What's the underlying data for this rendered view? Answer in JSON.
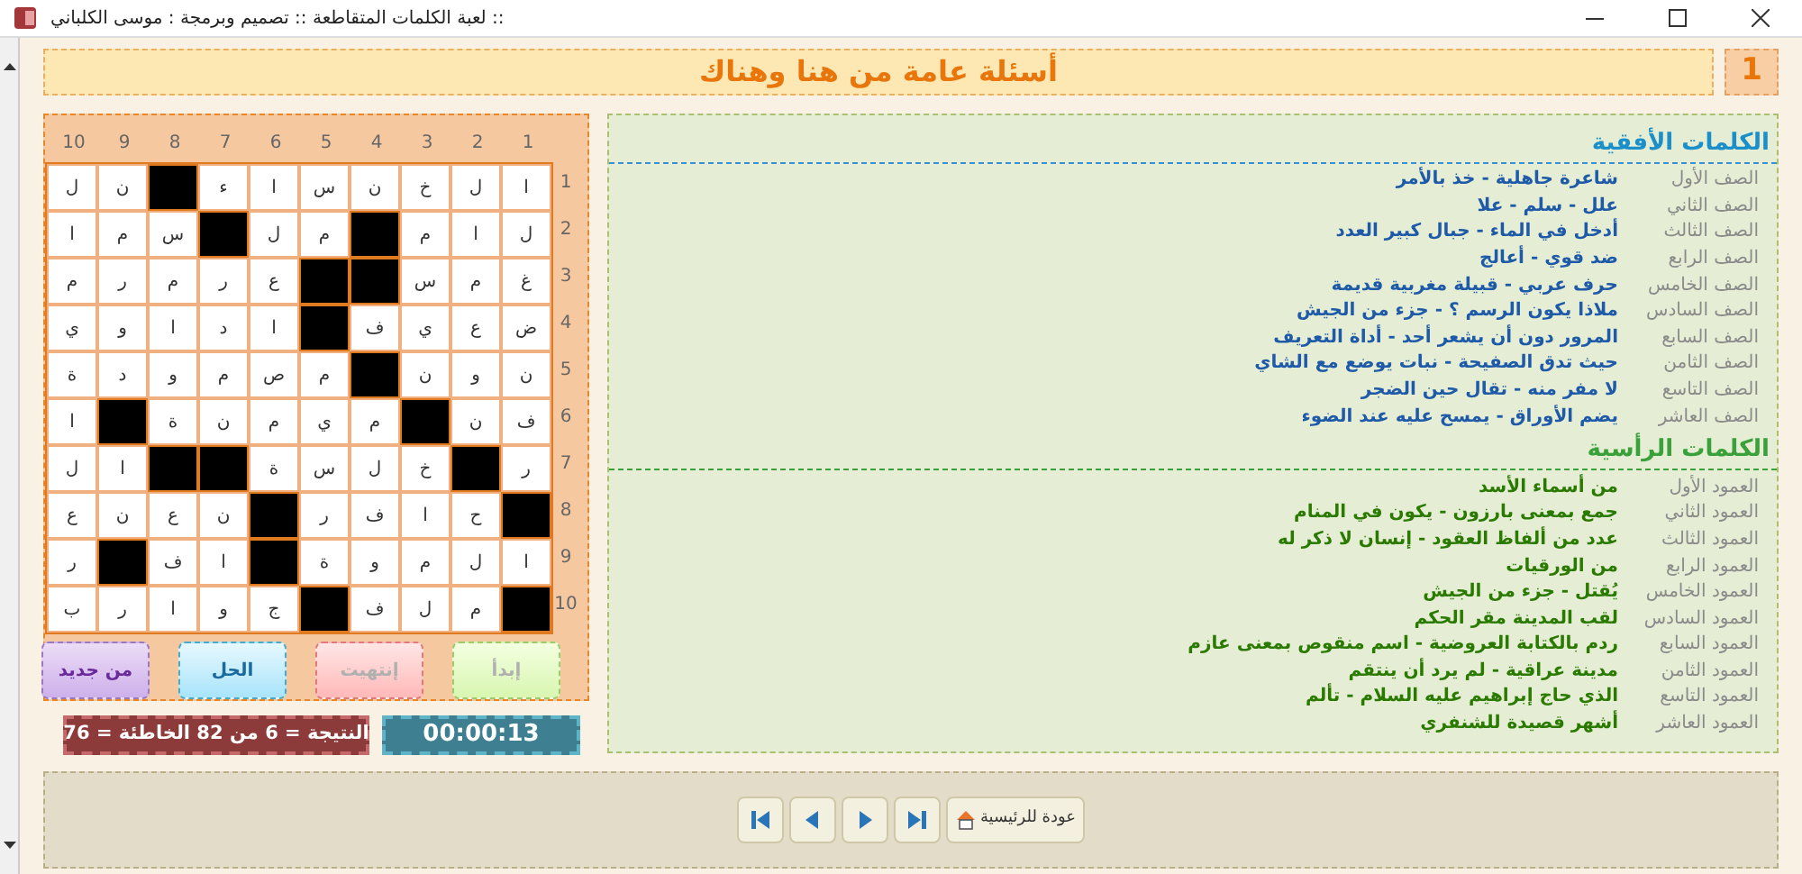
{
  "window": {
    "title": "لعبة الكلمات المتقاطعة :: تصميم وبرمجة : موسى الكلباني ::"
  },
  "header": {
    "number": "1",
    "title": "أسئلة عامة من هنا وهناك"
  },
  "grid": {
    "column_numbers": [
      "1",
      "2",
      "3",
      "4",
      "5",
      "6",
      "7",
      "8",
      "9",
      "10"
    ],
    "row_numbers": [
      "1",
      "2",
      "3",
      "4",
      "5",
      "6",
      "7",
      "8",
      "9",
      "10"
    ],
    "rows": [
      [
        {
          "letter": "ا",
          "black": false
        },
        {
          "letter": "ل",
          "black": false
        },
        {
          "letter": "خ",
          "black": false
        },
        {
          "letter": "ن",
          "black": false
        },
        {
          "letter": "س",
          "black": false
        },
        {
          "letter": "ا",
          "black": false
        },
        {
          "letter": "ء",
          "black": false
        },
        {
          "black": true
        },
        {
          "letter": "ن",
          "black": false
        },
        {
          "letter": "ل",
          "black": false
        }
      ],
      [
        {
          "letter": "ل",
          "black": false
        },
        {
          "letter": "ا",
          "black": false
        },
        {
          "letter": "م",
          "black": false
        },
        {
          "black": true
        },
        {
          "letter": "م",
          "black": false
        },
        {
          "letter": "ل",
          "black": false
        },
        {
          "black": true
        },
        {
          "letter": "س",
          "black": false
        },
        {
          "letter": "م",
          "black": false
        },
        {
          "letter": "ا",
          "black": false
        }
      ],
      [
        {
          "letter": "غ",
          "black": false
        },
        {
          "letter": "م",
          "black": false
        },
        {
          "letter": "س",
          "black": false
        },
        {
          "black": true
        },
        {
          "black": true
        },
        {
          "letter": "ع",
          "black": false
        },
        {
          "letter": "ر",
          "black": false
        },
        {
          "letter": "م",
          "black": false
        },
        {
          "letter": "ر",
          "black": false
        },
        {
          "letter": "م",
          "black": false
        }
      ],
      [
        {
          "letter": "ض",
          "black": false
        },
        {
          "letter": "ع",
          "black": false
        },
        {
          "letter": "ي",
          "black": false
        },
        {
          "letter": "ف",
          "black": false
        },
        {
          "black": true
        },
        {
          "letter": "ا",
          "black": false
        },
        {
          "letter": "د",
          "black": false
        },
        {
          "letter": "ا",
          "black": false
        },
        {
          "letter": "و",
          "black": false
        },
        {
          "letter": "ي",
          "black": false
        }
      ],
      [
        {
          "letter": "ن",
          "black": false
        },
        {
          "letter": "و",
          "black": false
        },
        {
          "letter": "ن",
          "black": false
        },
        {
          "black": true
        },
        {
          "letter": "م",
          "black": false
        },
        {
          "letter": "ص",
          "black": false
        },
        {
          "letter": "م",
          "black": false
        },
        {
          "letter": "و",
          "black": false
        },
        {
          "letter": "د",
          "black": false
        },
        {
          "letter": "ة",
          "black": false
        }
      ],
      [
        {
          "letter": "ف",
          "black": false
        },
        {
          "letter": "ن",
          "black": false
        },
        {
          "black": true
        },
        {
          "letter": "م",
          "black": false
        },
        {
          "letter": "ي",
          "black": false
        },
        {
          "letter": "م",
          "black": false
        },
        {
          "letter": "ن",
          "black": false
        },
        {
          "letter": "ة",
          "black": false
        },
        {
          "black": true
        },
        {
          "letter": "ا",
          "black": false
        }
      ],
      [
        {
          "letter": "ر",
          "black": false
        },
        {
          "black": true
        },
        {
          "letter": "خ",
          "black": false
        },
        {
          "letter": "ل",
          "black": false
        },
        {
          "letter": "س",
          "black": false
        },
        {
          "letter": "ة",
          "black": false
        },
        {
          "black": true
        },
        {
          "black": true
        },
        {
          "letter": "ا",
          "black": false
        },
        {
          "letter": "ل",
          "black": false
        }
      ],
      [
        {
          "black": true
        },
        {
          "letter": "ح",
          "black": false
        },
        {
          "letter": "ا",
          "black": false
        },
        {
          "letter": "ف",
          "black": false
        },
        {
          "letter": "ر",
          "black": false
        },
        {
          "black": true
        },
        {
          "letter": "ن",
          "black": false
        },
        {
          "letter": "ع",
          "black": false
        },
        {
          "letter": "ن",
          "black": false
        },
        {
          "letter": "ع",
          "black": false
        }
      ],
      [
        {
          "letter": "ا",
          "black": false
        },
        {
          "letter": "ل",
          "black": false
        },
        {
          "letter": "م",
          "black": false
        },
        {
          "letter": "و",
          "black": false
        },
        {
          "letter": "ة",
          "black": false
        },
        {
          "black": true
        },
        {
          "letter": "ا",
          "black": false
        },
        {
          "letter": "ف",
          "black": false
        },
        {
          "black": true
        },
        {
          "letter": "ر",
          "black": false
        }
      ],
      [
        {
          "black": true
        },
        {
          "letter": "م",
          "black": false
        },
        {
          "letter": "ل",
          "black": false
        },
        {
          "letter": "ف",
          "black": false
        },
        {
          "black": true
        },
        {
          "letter": "ج",
          "black": false
        },
        {
          "letter": "و",
          "black": false
        },
        {
          "letter": "ا",
          "black": false
        },
        {
          "letter": "ر",
          "black": false
        },
        {
          "letter": "ب",
          "black": false
        }
      ]
    ]
  },
  "buttons": [
    {
      "label": "إبدأ",
      "kind": "start",
      "disabled": true
    },
    {
      "label": "إنتهيت",
      "kind": "finish",
      "disabled": true
    },
    {
      "label": "الحل",
      "kind": "solve",
      "disabled": false
    },
    {
      "label": "من جديد",
      "kind": "restart",
      "disabled": false
    }
  ],
  "timer": "00:00:13",
  "score": "النتيجة = 6 من 82 الخاطئة = 76",
  "across": {
    "heading": "الكلمات الأفقية",
    "clues": [
      {
        "label": "الصف الأول",
        "text": "شاعرة جاهلية - خذ بالأمر"
      },
      {
        "label": "الصف الثاني",
        "text": "علل  -  سلم  -  علا"
      },
      {
        "label": "الصف الثالث",
        "text": "أدخل في الماء -  جبال كبير العدد"
      },
      {
        "label": "الصف الرابع",
        "text": "ضد قوي  -  أعالج"
      },
      {
        "label": "الصف الخامس",
        "text": "حرف عربي  -  قبيلة مغربية قديمة"
      },
      {
        "label": "الصف السادس",
        "text": "ملاذا يكون الرسم ؟ - جزء من الجيش"
      },
      {
        "label": "الصف السابع",
        "text": "المرور دون أن يشعر أحد  - أداة التعريف"
      },
      {
        "label": "الصف الثامن",
        "text": "حيث تدق الصفيحة  -  نبات يوضع مع الشاي"
      },
      {
        "label": "الصف التاسع",
        "text": "لا مفر منه  - تقال حين الضجر"
      },
      {
        "label": "الصف العاشر",
        "text": "يضم الأوراق  - يمسح عليه عند الضوء"
      }
    ]
  },
  "down": {
    "heading": "الكلمات الرأسية",
    "clues": [
      {
        "label": "العمود الأول",
        "text": "من أسماء الأسد"
      },
      {
        "label": "العمود الثاني",
        "text": "جمع بمعنى بارزون  -  يكون في المنام"
      },
      {
        "label": "العمود الثالث",
        "text": "عدد من ألفاظ العقود  -  إنسان لا ذكر له"
      },
      {
        "label": "العمود الرابع",
        "text": "من الورقيات"
      },
      {
        "label": "العمود الخامس",
        "text": "يُقتل - جزء من الجيش"
      },
      {
        "label": "العمود السادس",
        "text": "لقب المدينة مقر الحكم"
      },
      {
        "label": "العمود السابع",
        "text": "ردم بالكتابة العروضية  - اسم منقوص بمعنى عازم"
      },
      {
        "label": "العمود الثامن",
        "text": "مدينة عراقية  - لم يرد أن ينتقم"
      },
      {
        "label": "العمود التاسع",
        "text": "الذي حاج إبراهيم عليه السلام  -  تألم"
      },
      {
        "label": "العمود العاشر",
        "text": "أشهر قصيدة للشنفري"
      }
    ]
  },
  "nav": {
    "buttons": [
      {
        "kind": "first"
      },
      {
        "kind": "previous"
      },
      {
        "kind": "next"
      },
      {
        "kind": "last"
      }
    ],
    "home": "عودة للرئيسية"
  }
}
